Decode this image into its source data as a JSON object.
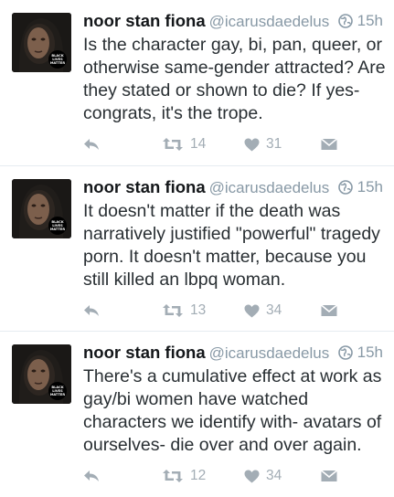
{
  "tweets": [
    {
      "name": "noor stan fiona",
      "handle": "@icarusdaedelus",
      "time": "15h",
      "text": "Is the character gay, bi, pan, queer, or otherwise same-gender attracted? Are they stated or shown to die? If yes- congrats, it's the trope.",
      "retweets": "14",
      "likes": "31"
    },
    {
      "name": "noor stan fiona",
      "handle": "@icarusdaedelus",
      "time": "15h",
      "text": "It doesn't matter if the death was narratively justified \"powerful\" tragedy porn. It doesn't matter, because you still killed an lbpq woman.",
      "retweets": "13",
      "likes": "34"
    },
    {
      "name": "noor stan fiona",
      "handle": "@icarusdaedelus",
      "time": "15h",
      "text": "There's a cumulative effect at work as gay/bi women have watched characters we identify with- avatars of ourselves- die over and over again.",
      "retweets": "12",
      "likes": "34"
    }
  ],
  "avatar_badge": [
    "BLACK",
    "LIVES",
    "MATTER"
  ],
  "icons": {
    "reply": "reply-icon",
    "retweet": "retweet-icon",
    "like": "heart-icon",
    "dm": "direct-message-icon",
    "privacy": "globe-icon"
  },
  "colors": {
    "icon_gray": "#a3adb5",
    "handle_gray": "#8899a6",
    "divider": "#e6ecf0"
  }
}
